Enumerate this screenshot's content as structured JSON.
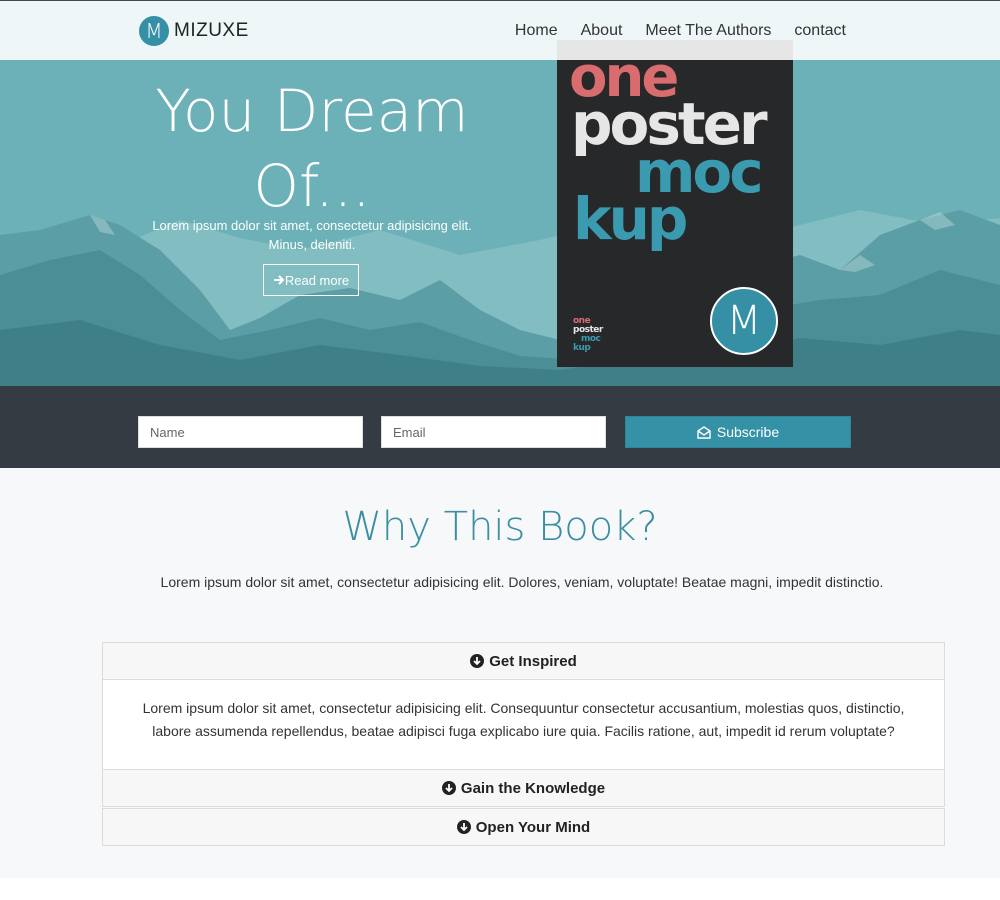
{
  "brand": {
    "logo_letter": "M",
    "name": "MIZUXE"
  },
  "nav": {
    "items": [
      "Home",
      "About",
      "Meet The Authors",
      "contact"
    ]
  },
  "hero": {
    "title_line1": "You Dream",
    "title_line2": "Of...",
    "text": "Lorem ipsum dolor sit amet, consectetur adipisicing elit. Minus, deleniti.",
    "button_label": "Read more",
    "button_icon": "arrow-right-icon"
  },
  "poster": {
    "words": [
      "one",
      "poster",
      "moc",
      "kup"
    ],
    "logo_letter": "M",
    "colors": {
      "coral": "#d96c6e",
      "teal": "#3a9bb0",
      "light": "#e6e6e6",
      "bg": "#27282a"
    }
  },
  "subscribe": {
    "name_placeholder": "Name",
    "email_placeholder": "Email",
    "button_label": "Subscribe",
    "button_icon": "envelope-open-icon"
  },
  "why": {
    "title": "Why This Book?",
    "text": "Lorem ipsum dolor sit amet, consectetur adipisicing elit. Dolores, veniam, voluptate! Beatae magni, impedit distinctio."
  },
  "accordion": {
    "items": [
      {
        "title": "Get Inspired",
        "icon": "arrow-circle-down-icon",
        "body": "Lorem ipsum dolor sit amet, consectetur adipisicing elit. Consequuntur consectetur accusantium, molestias quos, distinctio, labore assumenda repellendus, beatae adipisci fuga explicabo iure quia. Facilis ratione, aut, impedit id rerum voluptate?"
      },
      {
        "title": "Gain the Knowledge",
        "icon": "arrow-circle-down-icon"
      },
      {
        "title": "Open Your Mind",
        "icon": "arrow-circle-down-icon"
      }
    ]
  },
  "colors": {
    "accent": "#3590a5",
    "hero_bg": "#6ab0b6",
    "subscribe_bg": "#353b43"
  }
}
